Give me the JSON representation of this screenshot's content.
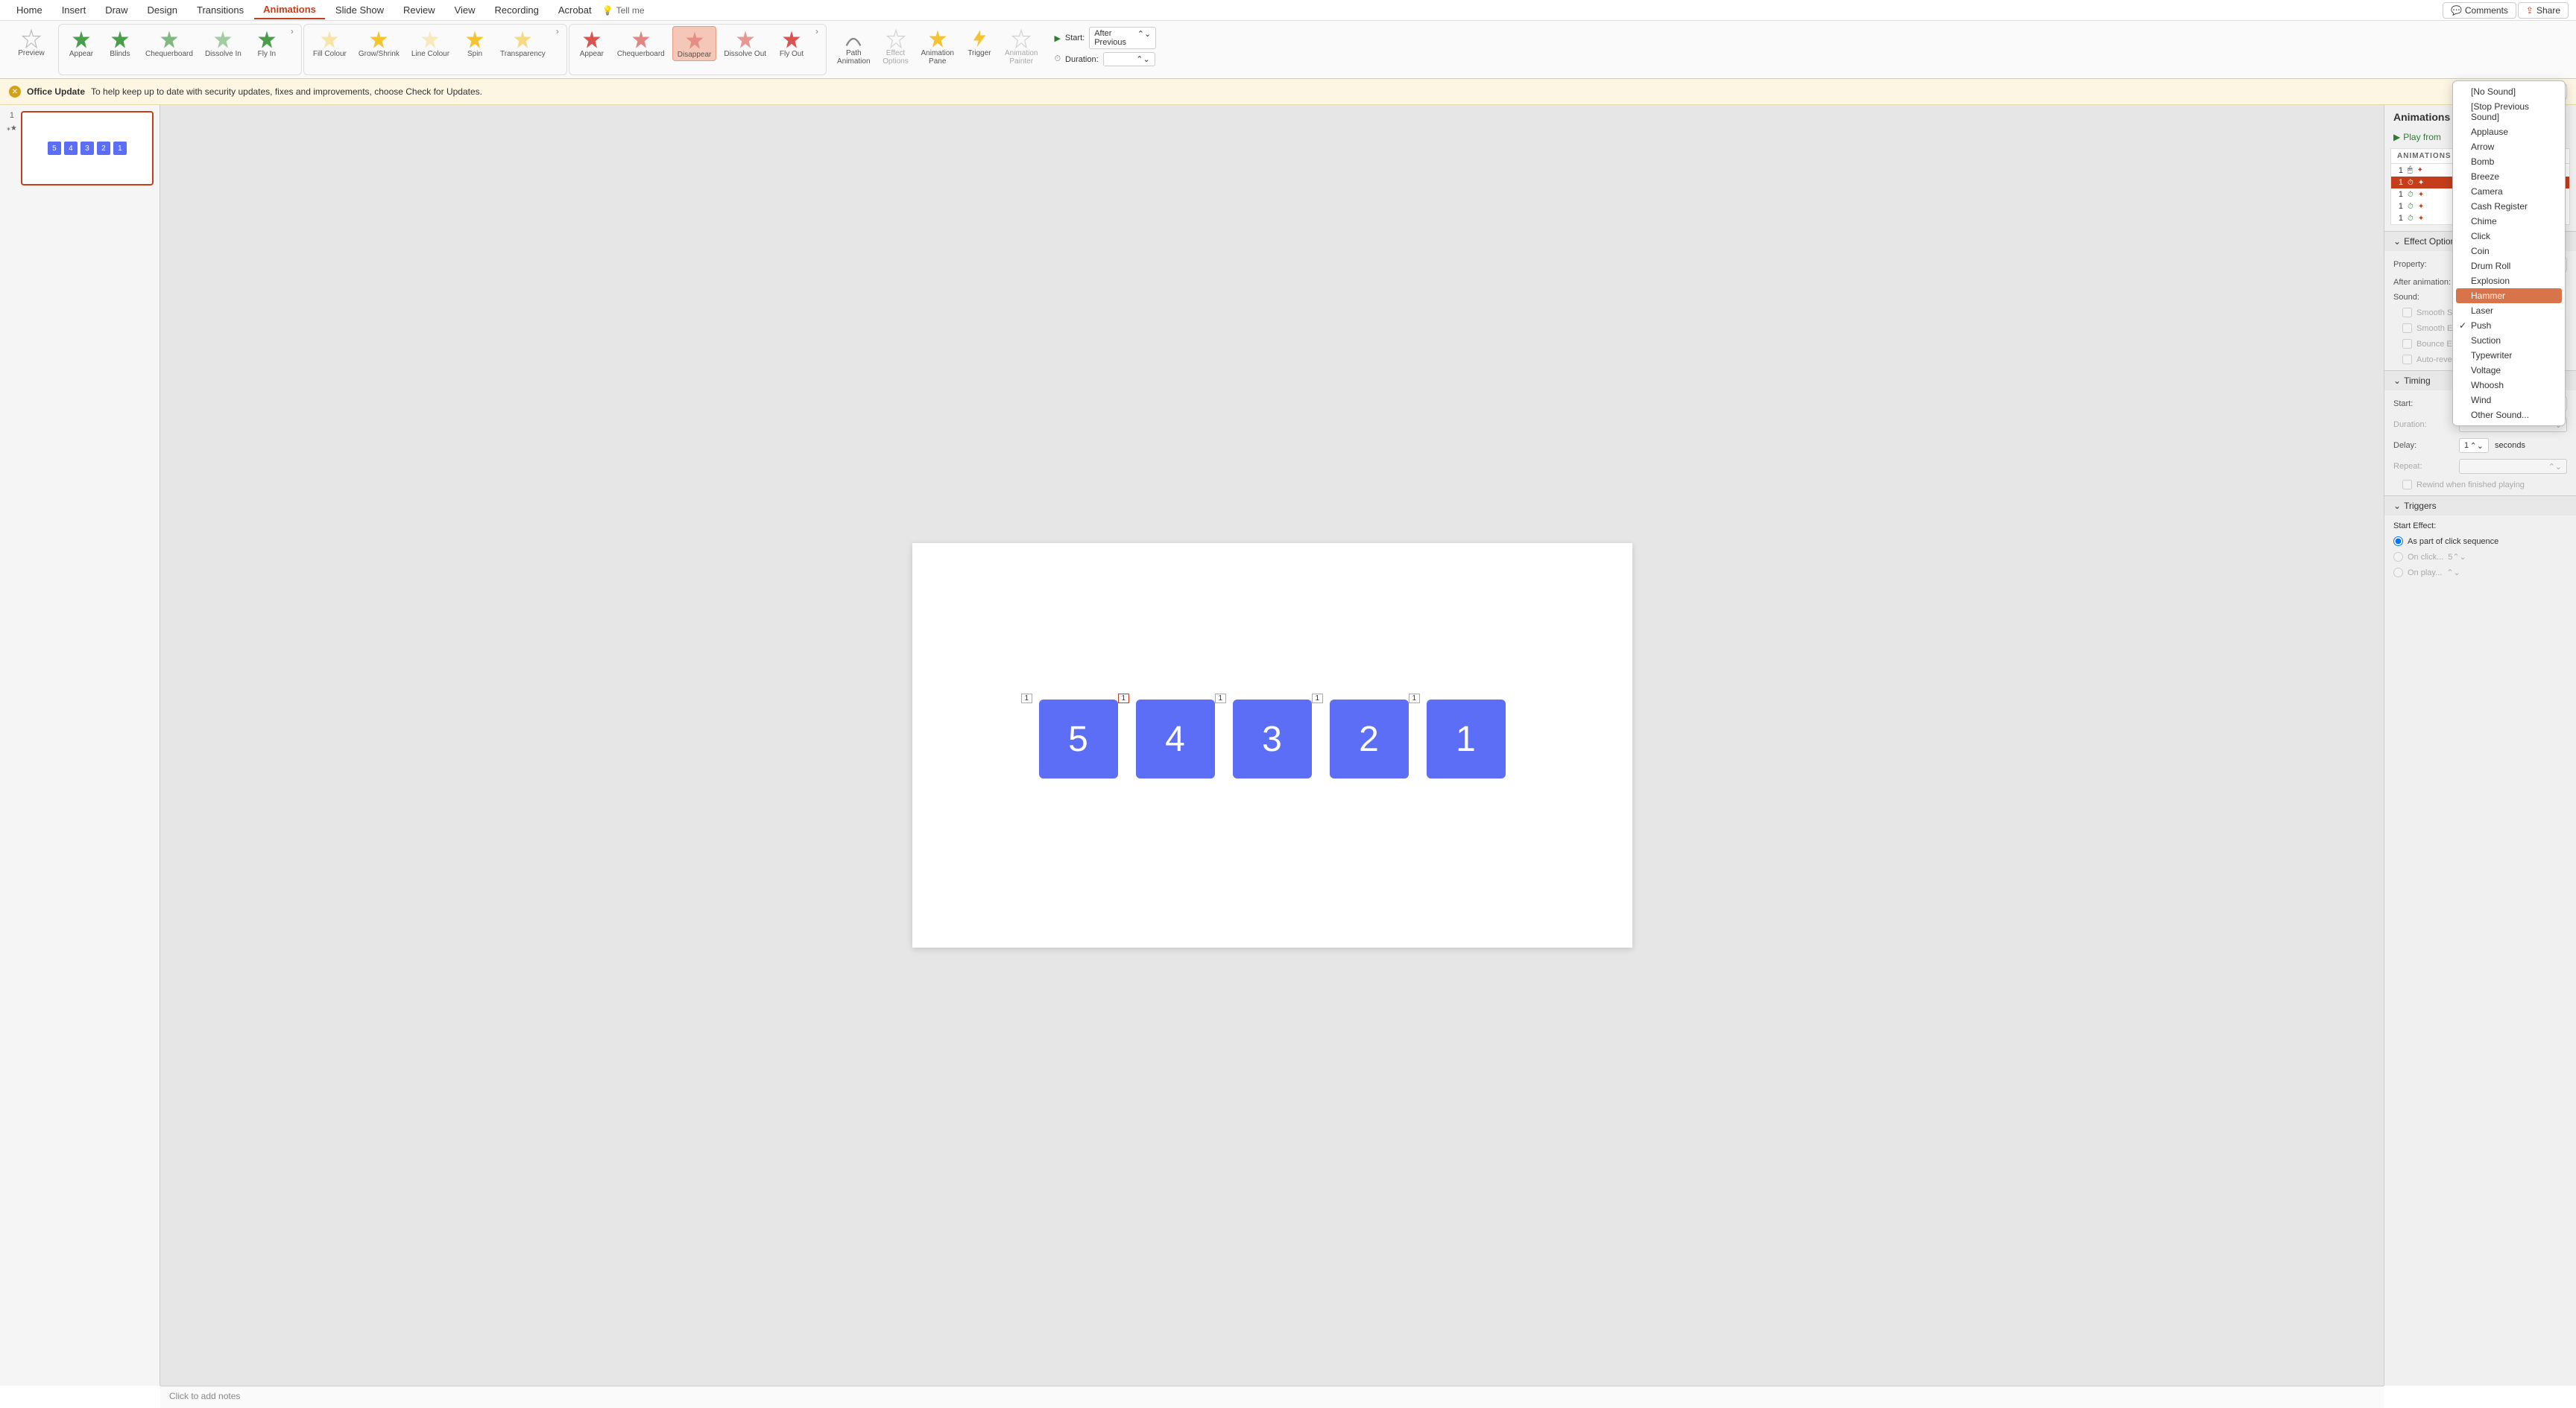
{
  "tabs": [
    "Home",
    "Insert",
    "Draw",
    "Design",
    "Transitions",
    "Animations",
    "Slide Show",
    "Review",
    "View",
    "Recording",
    "Acrobat"
  ],
  "active_tab": "Animations",
  "tellme": "Tell me",
  "comments_btn": "Comments",
  "share_btn": "Share",
  "preview_label": "Preview",
  "entrance_effects": [
    "Appear",
    "Blinds",
    "Chequerboard",
    "Dissolve In",
    "Fly In"
  ],
  "emphasis_effects": [
    "Fill Colour",
    "Grow/Shrink",
    "Line Colour",
    "Spin",
    "Transparency"
  ],
  "exit_effects": [
    "Appear",
    "Chequerboard",
    "Disappear",
    "Dissolve Out",
    "Fly Out"
  ],
  "selected_exit": "Disappear",
  "adv_items": [
    {
      "label": "Path\nAnimation"
    },
    {
      "label": "Effect\nOptions"
    },
    {
      "label": "Animation\nPane"
    },
    {
      "label": "Trigger"
    },
    {
      "label": "Animation\nPainter"
    }
  ],
  "start_label": "Start:",
  "start_value": "After Previous",
  "duration_label": "Duration:",
  "update_title": "Office Update",
  "update_msg": "To help keep up to date with security updates, fixes and improvements, choose Check for Updates.",
  "check_updates": "Check for Updates",
  "slide_number": "1",
  "thumb_boxes": [
    "5",
    "4",
    "3",
    "2",
    "1"
  ],
  "canvas_boxes": [
    {
      "tag": "1",
      "num": "5",
      "selected": false
    },
    {
      "tag": "1",
      "num": "4",
      "selected": true
    },
    {
      "tag": "1",
      "num": "3",
      "selected": false
    },
    {
      "tag": "1",
      "num": "2",
      "selected": false
    },
    {
      "tag": "1",
      "num": "1",
      "selected": false
    }
  ],
  "pane_title": "Animations",
  "play_from": "Play from",
  "anim_list_header": "ANIMATIONS",
  "anim_rows": [
    {
      "num": "1",
      "icon": "cursor",
      "selected": false
    },
    {
      "num": "1",
      "icon": "clock",
      "selected": true
    },
    {
      "num": "1",
      "icon": "clock",
      "selected": false
    },
    {
      "num": "1",
      "icon": "clock",
      "selected": false
    },
    {
      "num": "1",
      "icon": "clock",
      "selected": false
    }
  ],
  "effect_options_header": "Effect Options",
  "property_label": "Property:",
  "after_anim_label": "After animation:",
  "sound_label": "Sound:",
  "smooth_start": "Smooth Start",
  "smooth_end": "Smooth End",
  "bounce_end": "Bounce End",
  "auto_reverse": "Auto-reverse",
  "timing_header": "Timing",
  "timing_start_label": "Start:",
  "timing_start_value": "After Previous",
  "timing_duration_label": "Duration:",
  "delay_label": "Delay:",
  "delay_value": "1",
  "delay_unit": "seconds",
  "repeat_label": "Repeat:",
  "rewind_label": "Rewind when finished playing",
  "triggers_header": "Triggers",
  "start_effect_label": "Start Effect:",
  "trigger_radio1": "As part of click sequence",
  "trigger_radio2": "On click...",
  "trigger_radio3": "On play...",
  "trigger_val2": "5",
  "notes_placeholder": "Click to add notes",
  "sound_options": [
    "[No Sound]",
    "[Stop Previous Sound]",
    "Applause",
    "Arrow",
    "Bomb",
    "Breeze",
    "Camera",
    "Cash Register",
    "Chime",
    "Click",
    "Coin",
    "Drum Roll",
    "Explosion",
    "Hammer",
    "Laser",
    "Push",
    "Suction",
    "Typewriter",
    "Voltage",
    "Whoosh",
    "Wind",
    "Other Sound..."
  ],
  "sound_highlighted": "Hammer",
  "sound_checked": "Push"
}
